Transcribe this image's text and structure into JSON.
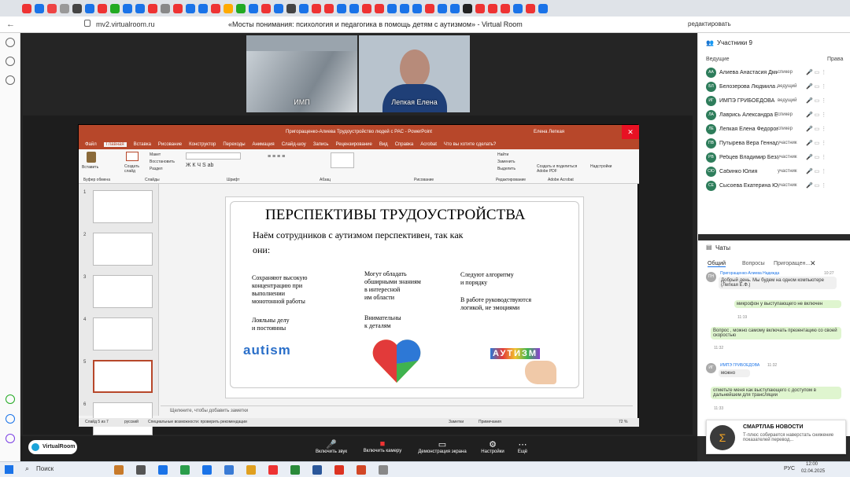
{
  "browser": {
    "url": "mv2.virtualroom.ru",
    "title": "«Мосты понимания: психология и педагогика в помощь детям с аутизмом» - Virtual Room",
    "edit": "редактировать",
    "tab_colors": [
      "#e33",
      "#1a73e8",
      "#e44",
      "#999",
      "#444",
      "#1a73e8",
      "#e33",
      "#2a2",
      "#1a73e8",
      "#1a73e8",
      "#e33",
      "#888",
      "#e33",
      "#1a73e8",
      "#1a73e8",
      "#e33",
      "#fa0",
      "#2a2",
      "#1a73e8",
      "#e33",
      "#1a73e8",
      "#444",
      "#1a73e8",
      "#e33",
      "#e33",
      "#1a73e8",
      "#1a73e8",
      "#e33",
      "#e33",
      "#1a73e8",
      "#1a73e8",
      "#1a73e8",
      "#e33",
      "#1a73e8",
      "#1a73e8",
      "#222",
      "#e33",
      "#e33",
      "#e33",
      "#1a73e8",
      "#e33",
      "#1a73e8"
    ]
  },
  "videos": [
    {
      "name": "ИМП"
    },
    {
      "name": "Лепкая Елена"
    }
  ],
  "ppt": {
    "title": "Пригоращенко-Алиева Трудоустройство людей с РАС - PowerPoint",
    "user": "Елена Лепкая",
    "tabs": [
      "Файл",
      "Главная",
      "Вставка",
      "Рисование",
      "Конструктор",
      "Переходы",
      "Анимация",
      "Слайд-шоу",
      "Запись",
      "Рецензирование",
      "Вид",
      "Справка",
      "Acrobat",
      "Что вы хотите сделать?"
    ],
    "ribbon": {
      "paste": "Вставить",
      "create": "Создать слайд",
      "layout": "Макет",
      "reset": "Восстановить",
      "section": "Раздел",
      "clipboard": "Буфер обмена",
      "slides": "Слайды",
      "font": "Шрифт",
      "para": "Абзац",
      "drawing": "Рисование",
      "edit": "Редактирование",
      "find": "Найти",
      "replace": "Заменить",
      "select": "Выделить",
      "pdf": "Создать и поделиться Adobe PDF",
      "addin": "Надстройки",
      "acrobat": "Adobe Acrobat"
    },
    "slide": {
      "title": "ПЕРСПЕКТИВЫ ТРУДОУСТРОЙСТВА",
      "intro1": "Наём сотрудников с аутизмом перспективен, так как",
      "intro2": "они:",
      "c1a": "Сохраняют высокую",
      "c1b": "концентрацию при",
      "c1c": "выполнении",
      "c1d": "монотонной работы",
      "c1e": "Лояльны делу",
      "c1f": "и постоянны",
      "c2a": "Могут обладать",
      "c2b": "обширными знаниям",
      "c2c": "в интересной",
      "c2d": "им области",
      "c2e": "Внимательны",
      "c2f": "к деталям",
      "c3a": "Следуют алгоритму",
      "c3b": "и порядку",
      "c3c": "В работе руководствуются",
      "c3d": "логикой, не эмоциями",
      "logo": "autism",
      "puzzle": "АУТИЗМ"
    },
    "thumbs": [
      "1",
      "2",
      "3",
      "4",
      "5",
      "6"
    ],
    "notes": "Щелкните, чтобы добавить заметки",
    "status": {
      "slide": "Слайд 5 из 7",
      "lang": "русский",
      "access": "Специальные возможности: проверить рекомендации",
      "notes": "Заметки",
      "comments": "Примечания",
      "zoom": "72 %"
    }
  },
  "panel": {
    "participants": "Участники 9",
    "leaders": "Ведущие",
    "right": "Права",
    "people": [
      {
        "i": "АА",
        "n": "Алиева Анастасия Дмитри...",
        "r": "спикер"
      },
      {
        "i": "БЛ",
        "n": "Белозерова Людмила А...",
        "r": "ведущий"
      },
      {
        "i": "ИГ",
        "n": "ИМПЭ ГРИБОЕДОВА",
        "r": "ведущий"
      },
      {
        "i": "ЛА",
        "n": "Лаврись Александра Евген...",
        "r": "спикер"
      },
      {
        "i": "ЛЕ",
        "n": "Лепкая Елена Федоровна",
        "r": "спикер"
      },
      {
        "i": "ПВ",
        "n": "Путырева Вера Геннадье...",
        "r": "участник"
      },
      {
        "i": "РВ",
        "n": "Ребцев Владимир Безан...",
        "r": "участник"
      },
      {
        "i": "СЮ",
        "n": "Сабинко Юлия",
        "r": "участник"
      },
      {
        "i": "СЕ",
        "n": "Сысоева Екатерина Юрь...",
        "r": "участник"
      }
    ],
    "chats": "Чаты",
    "tabs": [
      "Общий",
      "Вопросы",
      "Пригоращен..."
    ],
    "m1n": "Пригоращенко-Алиева Надежда",
    "m1t": "10:27",
    "m1": "Добрый день. Мы будем на одном компьютере (Лепкая Е.Ф.)",
    "m2": "микрофон у выступающего не включен",
    "m2t": "11:19",
    "m3": "Вопрос , можно самому включать презентацию со своей скоростью",
    "m3t": "11:32",
    "m4n": "ИМПЭ ГРИБОЕДОВА",
    "m4t": "11:32",
    "m4": "можно",
    "m5": "отметьте меня как выступающего с доступом в дальнейшем для трансляции",
    "m5t": "11:33",
    "notif_t": "СМАРТЛАБ НОВОСТИ",
    "notif": "Т-плюс собирается наверстать снижение показателей перевод..."
  },
  "controls": [
    "Включить звук",
    "Включить камеру",
    "Демонстрация экрана",
    "Настройки",
    "Ещё"
  ],
  "vr": "VirtualRoom",
  "taskbar": {
    "search": "Поиск",
    "lang": "РУС",
    "time": "12:00",
    "date": "02.04.2025"
  }
}
